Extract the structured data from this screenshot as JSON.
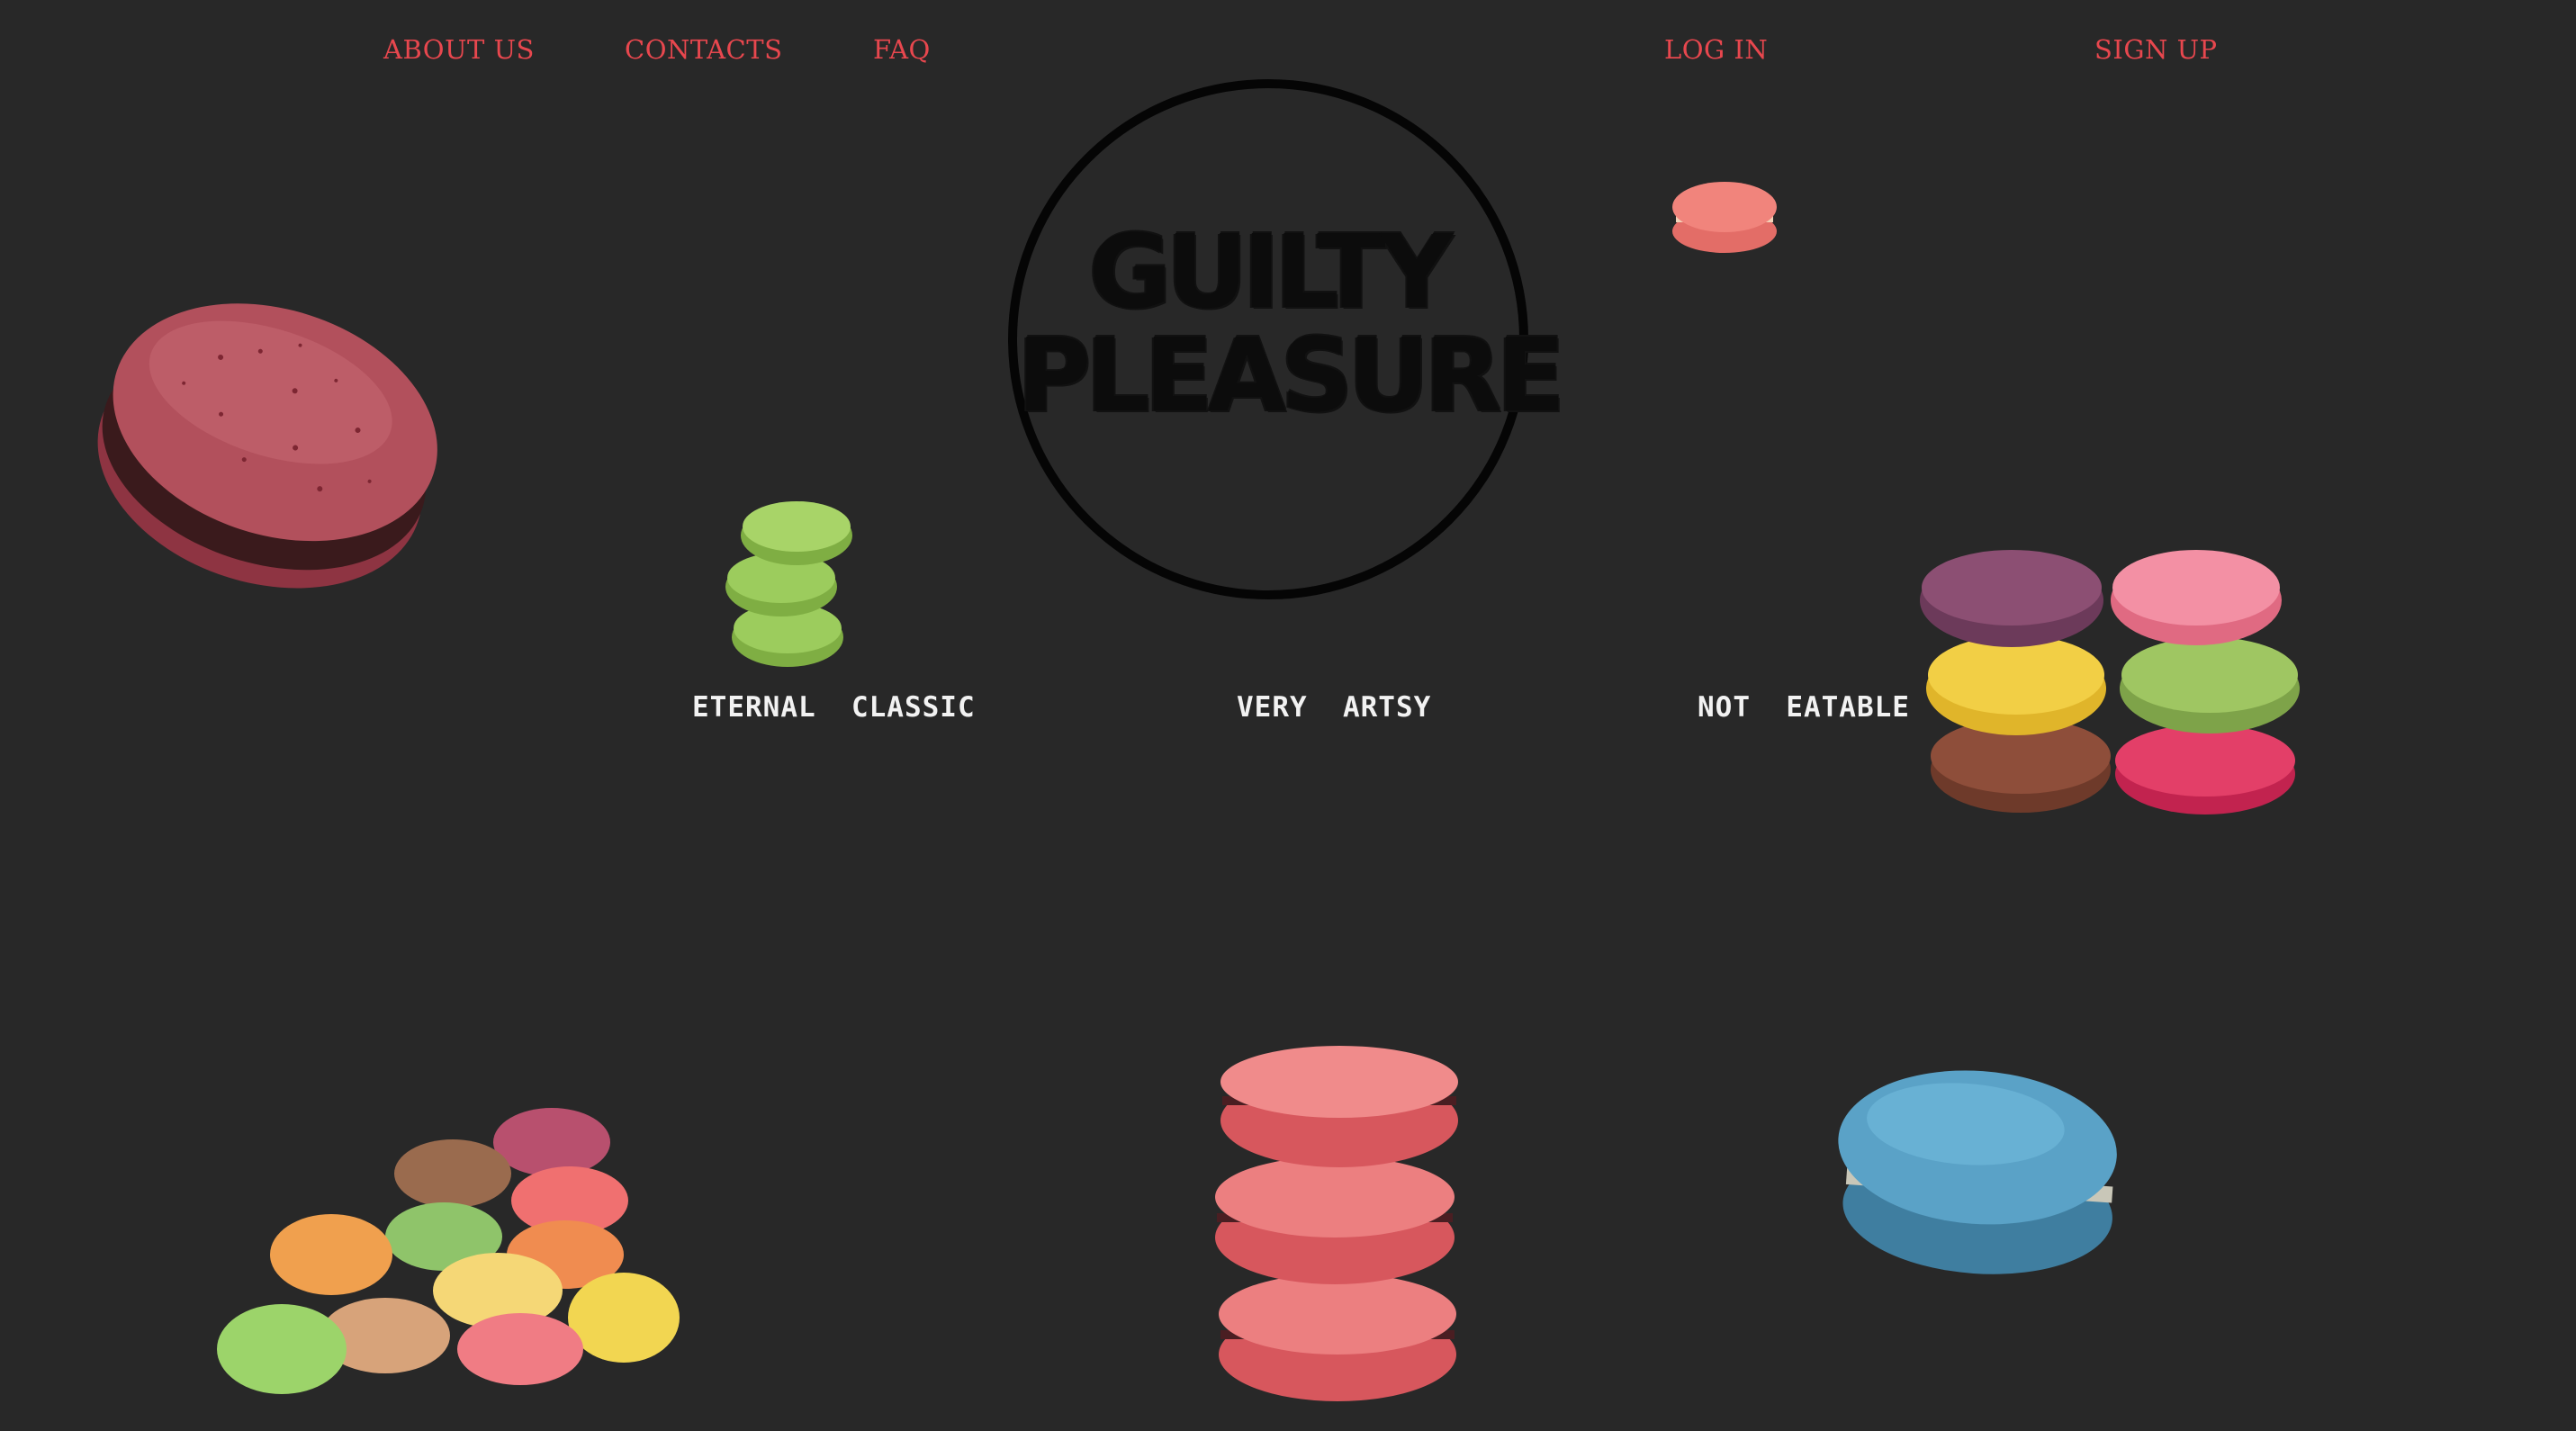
{
  "nav": {
    "about_us": "ABOUT US",
    "contacts": "CONTACTS",
    "faq": "FAQ",
    "log_in": "LOG IN",
    "sign_up": "SIGN UP"
  },
  "logo": {
    "line1": "GUILTY",
    "line2": "PLEASURE"
  },
  "categories": {
    "eternal_classic": "ETERNAL  CLASSIC",
    "very_artsy": "VERY  ARTSY",
    "not_eatable": "NOT  EATABLE"
  },
  "colors": {
    "background": "#282828",
    "nav_link": "#e8474e",
    "caption": "#f2f2f2",
    "logo": "#050505"
  }
}
